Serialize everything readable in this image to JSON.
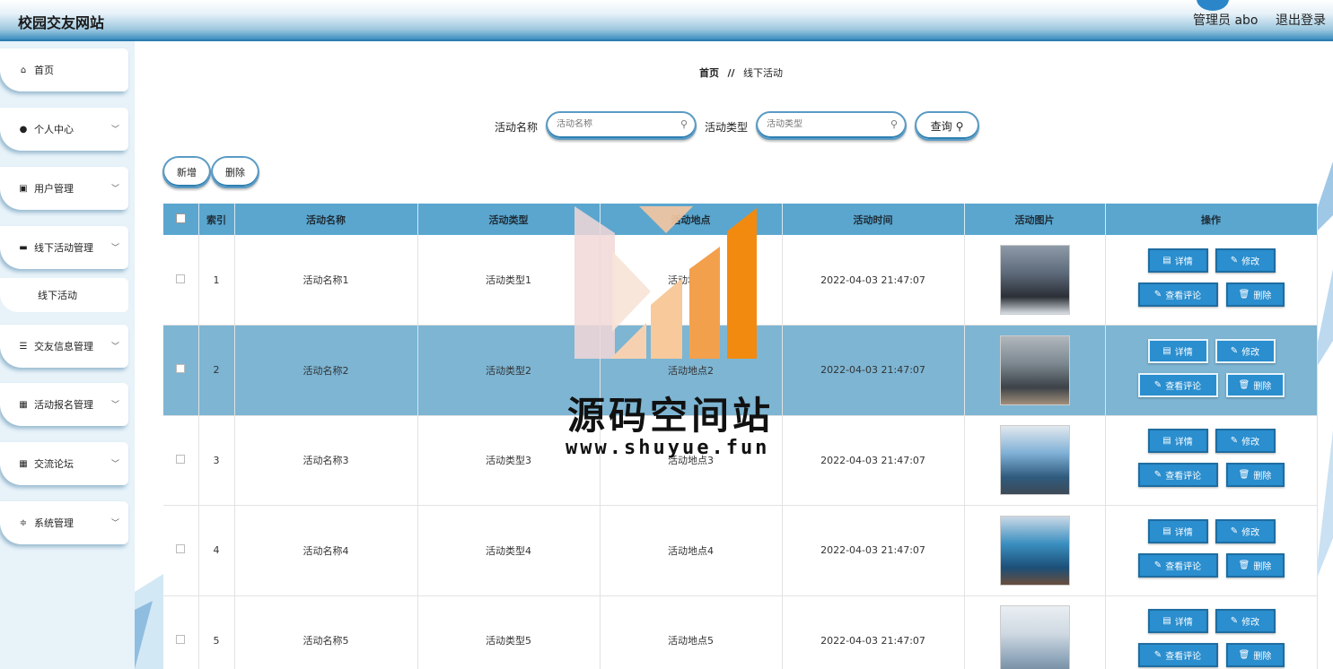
{
  "app": {
    "title": "校园交友网站"
  },
  "header": {
    "admin_label": "管理员 abo",
    "logout_label": "退出登录"
  },
  "sidebar": {
    "items": [
      {
        "label": "首页",
        "icon": "home-icon"
      },
      {
        "label": "个人中心",
        "icon": "user-icon"
      },
      {
        "label": "用户管理",
        "icon": "clipboard-icon"
      },
      {
        "label": "线下活动管理",
        "icon": "briefcase-icon"
      },
      {
        "label": "线下活动",
        "icon": ""
      },
      {
        "label": "交友信息管理",
        "icon": "list-icon"
      },
      {
        "label": "活动报名管理",
        "icon": "grid-icon"
      },
      {
        "label": "交流论坛",
        "icon": "grid-icon"
      },
      {
        "label": "系统管理",
        "icon": "sliders-icon"
      }
    ]
  },
  "breadcrumb": {
    "home": "首页",
    "separator": "//",
    "current": "线下活动"
  },
  "search": {
    "name_label": "活动名称",
    "name_placeholder": "活动名称",
    "type_label": "活动类型",
    "type_placeholder": "活动类型",
    "query_label": "查询"
  },
  "toolbar": {
    "add_label": "新增",
    "delete_label": "删除"
  },
  "table": {
    "headers": [
      "索引",
      "活动名称",
      "活动类型",
      "活动地点",
      "活动时间",
      "活动图片",
      "操作"
    ],
    "rows": [
      {
        "index": "1",
        "name": "活动名称1",
        "type": "活动类型1",
        "place": "活动地点1",
        "time": "2022-04-03 21:47:07"
      },
      {
        "index": "2",
        "name": "活动名称2",
        "type": "活动类型2",
        "place": "活动地点2",
        "time": "2022-04-03 21:47:07"
      },
      {
        "index": "3",
        "name": "活动名称3",
        "type": "活动类型3",
        "place": "活动地点3",
        "time": "2022-04-03 21:47:07"
      },
      {
        "index": "4",
        "name": "活动名称4",
        "type": "活动类型4",
        "place": "活动地点4",
        "time": "2022-04-03 21:47:07"
      },
      {
        "index": "5",
        "name": "活动名称5",
        "type": "活动类型5",
        "place": "活动地点5",
        "time": "2022-04-03 21:47:07"
      }
    ],
    "actions": {
      "detail": "详情",
      "edit": "修改",
      "comments": "查看评论",
      "delete": "删除"
    }
  },
  "watermark": {
    "title": "源码空间站",
    "url": "www.shuyue.fun"
  },
  "colors": {
    "header_accent": "#2a7db0",
    "table_header": "#5aa6cf",
    "row_highlight": "#7db5d3",
    "action_button": "#2a8ecf"
  }
}
